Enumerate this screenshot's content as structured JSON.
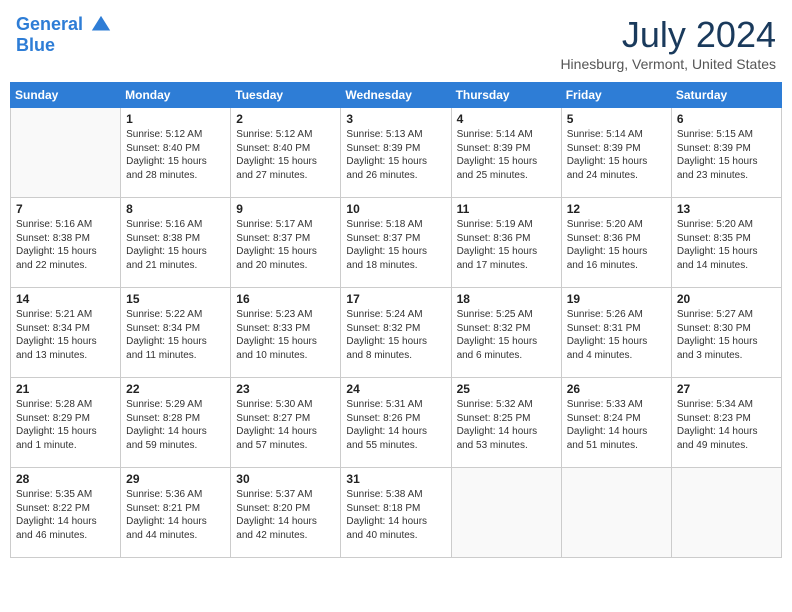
{
  "header": {
    "logo_line1": "General",
    "logo_line2": "Blue",
    "month": "July 2024",
    "location": "Hinesburg, Vermont, United States"
  },
  "days_of_week": [
    "Sunday",
    "Monday",
    "Tuesday",
    "Wednesday",
    "Thursday",
    "Friday",
    "Saturday"
  ],
  "weeks": [
    [
      {
        "day": "",
        "info": ""
      },
      {
        "day": "1",
        "info": "Sunrise: 5:12 AM\nSunset: 8:40 PM\nDaylight: 15 hours\nand 28 minutes."
      },
      {
        "day": "2",
        "info": "Sunrise: 5:12 AM\nSunset: 8:40 PM\nDaylight: 15 hours\nand 27 minutes."
      },
      {
        "day": "3",
        "info": "Sunrise: 5:13 AM\nSunset: 8:39 PM\nDaylight: 15 hours\nand 26 minutes."
      },
      {
        "day": "4",
        "info": "Sunrise: 5:14 AM\nSunset: 8:39 PM\nDaylight: 15 hours\nand 25 minutes."
      },
      {
        "day": "5",
        "info": "Sunrise: 5:14 AM\nSunset: 8:39 PM\nDaylight: 15 hours\nand 24 minutes."
      },
      {
        "day": "6",
        "info": "Sunrise: 5:15 AM\nSunset: 8:39 PM\nDaylight: 15 hours\nand 23 minutes."
      }
    ],
    [
      {
        "day": "7",
        "info": "Sunrise: 5:16 AM\nSunset: 8:38 PM\nDaylight: 15 hours\nand 22 minutes."
      },
      {
        "day": "8",
        "info": "Sunrise: 5:16 AM\nSunset: 8:38 PM\nDaylight: 15 hours\nand 21 minutes."
      },
      {
        "day": "9",
        "info": "Sunrise: 5:17 AM\nSunset: 8:37 PM\nDaylight: 15 hours\nand 20 minutes."
      },
      {
        "day": "10",
        "info": "Sunrise: 5:18 AM\nSunset: 8:37 PM\nDaylight: 15 hours\nand 18 minutes."
      },
      {
        "day": "11",
        "info": "Sunrise: 5:19 AM\nSunset: 8:36 PM\nDaylight: 15 hours\nand 17 minutes."
      },
      {
        "day": "12",
        "info": "Sunrise: 5:20 AM\nSunset: 8:36 PM\nDaylight: 15 hours\nand 16 minutes."
      },
      {
        "day": "13",
        "info": "Sunrise: 5:20 AM\nSunset: 8:35 PM\nDaylight: 15 hours\nand 14 minutes."
      }
    ],
    [
      {
        "day": "14",
        "info": "Sunrise: 5:21 AM\nSunset: 8:34 PM\nDaylight: 15 hours\nand 13 minutes."
      },
      {
        "day": "15",
        "info": "Sunrise: 5:22 AM\nSunset: 8:34 PM\nDaylight: 15 hours\nand 11 minutes."
      },
      {
        "day": "16",
        "info": "Sunrise: 5:23 AM\nSunset: 8:33 PM\nDaylight: 15 hours\nand 10 minutes."
      },
      {
        "day": "17",
        "info": "Sunrise: 5:24 AM\nSunset: 8:32 PM\nDaylight: 15 hours\nand 8 minutes."
      },
      {
        "day": "18",
        "info": "Sunrise: 5:25 AM\nSunset: 8:32 PM\nDaylight: 15 hours\nand 6 minutes."
      },
      {
        "day": "19",
        "info": "Sunrise: 5:26 AM\nSunset: 8:31 PM\nDaylight: 15 hours\nand 4 minutes."
      },
      {
        "day": "20",
        "info": "Sunrise: 5:27 AM\nSunset: 8:30 PM\nDaylight: 15 hours\nand 3 minutes."
      }
    ],
    [
      {
        "day": "21",
        "info": "Sunrise: 5:28 AM\nSunset: 8:29 PM\nDaylight: 15 hours\nand 1 minute."
      },
      {
        "day": "22",
        "info": "Sunrise: 5:29 AM\nSunset: 8:28 PM\nDaylight: 14 hours\nand 59 minutes."
      },
      {
        "day": "23",
        "info": "Sunrise: 5:30 AM\nSunset: 8:27 PM\nDaylight: 14 hours\nand 57 minutes."
      },
      {
        "day": "24",
        "info": "Sunrise: 5:31 AM\nSunset: 8:26 PM\nDaylight: 14 hours\nand 55 minutes."
      },
      {
        "day": "25",
        "info": "Sunrise: 5:32 AM\nSunset: 8:25 PM\nDaylight: 14 hours\nand 53 minutes."
      },
      {
        "day": "26",
        "info": "Sunrise: 5:33 AM\nSunset: 8:24 PM\nDaylight: 14 hours\nand 51 minutes."
      },
      {
        "day": "27",
        "info": "Sunrise: 5:34 AM\nSunset: 8:23 PM\nDaylight: 14 hours\nand 49 minutes."
      }
    ],
    [
      {
        "day": "28",
        "info": "Sunrise: 5:35 AM\nSunset: 8:22 PM\nDaylight: 14 hours\nand 46 minutes."
      },
      {
        "day": "29",
        "info": "Sunrise: 5:36 AM\nSunset: 8:21 PM\nDaylight: 14 hours\nand 44 minutes."
      },
      {
        "day": "30",
        "info": "Sunrise: 5:37 AM\nSunset: 8:20 PM\nDaylight: 14 hours\nand 42 minutes."
      },
      {
        "day": "31",
        "info": "Sunrise: 5:38 AM\nSunset: 8:18 PM\nDaylight: 14 hours\nand 40 minutes."
      },
      {
        "day": "",
        "info": ""
      },
      {
        "day": "",
        "info": ""
      },
      {
        "day": "",
        "info": ""
      }
    ]
  ]
}
